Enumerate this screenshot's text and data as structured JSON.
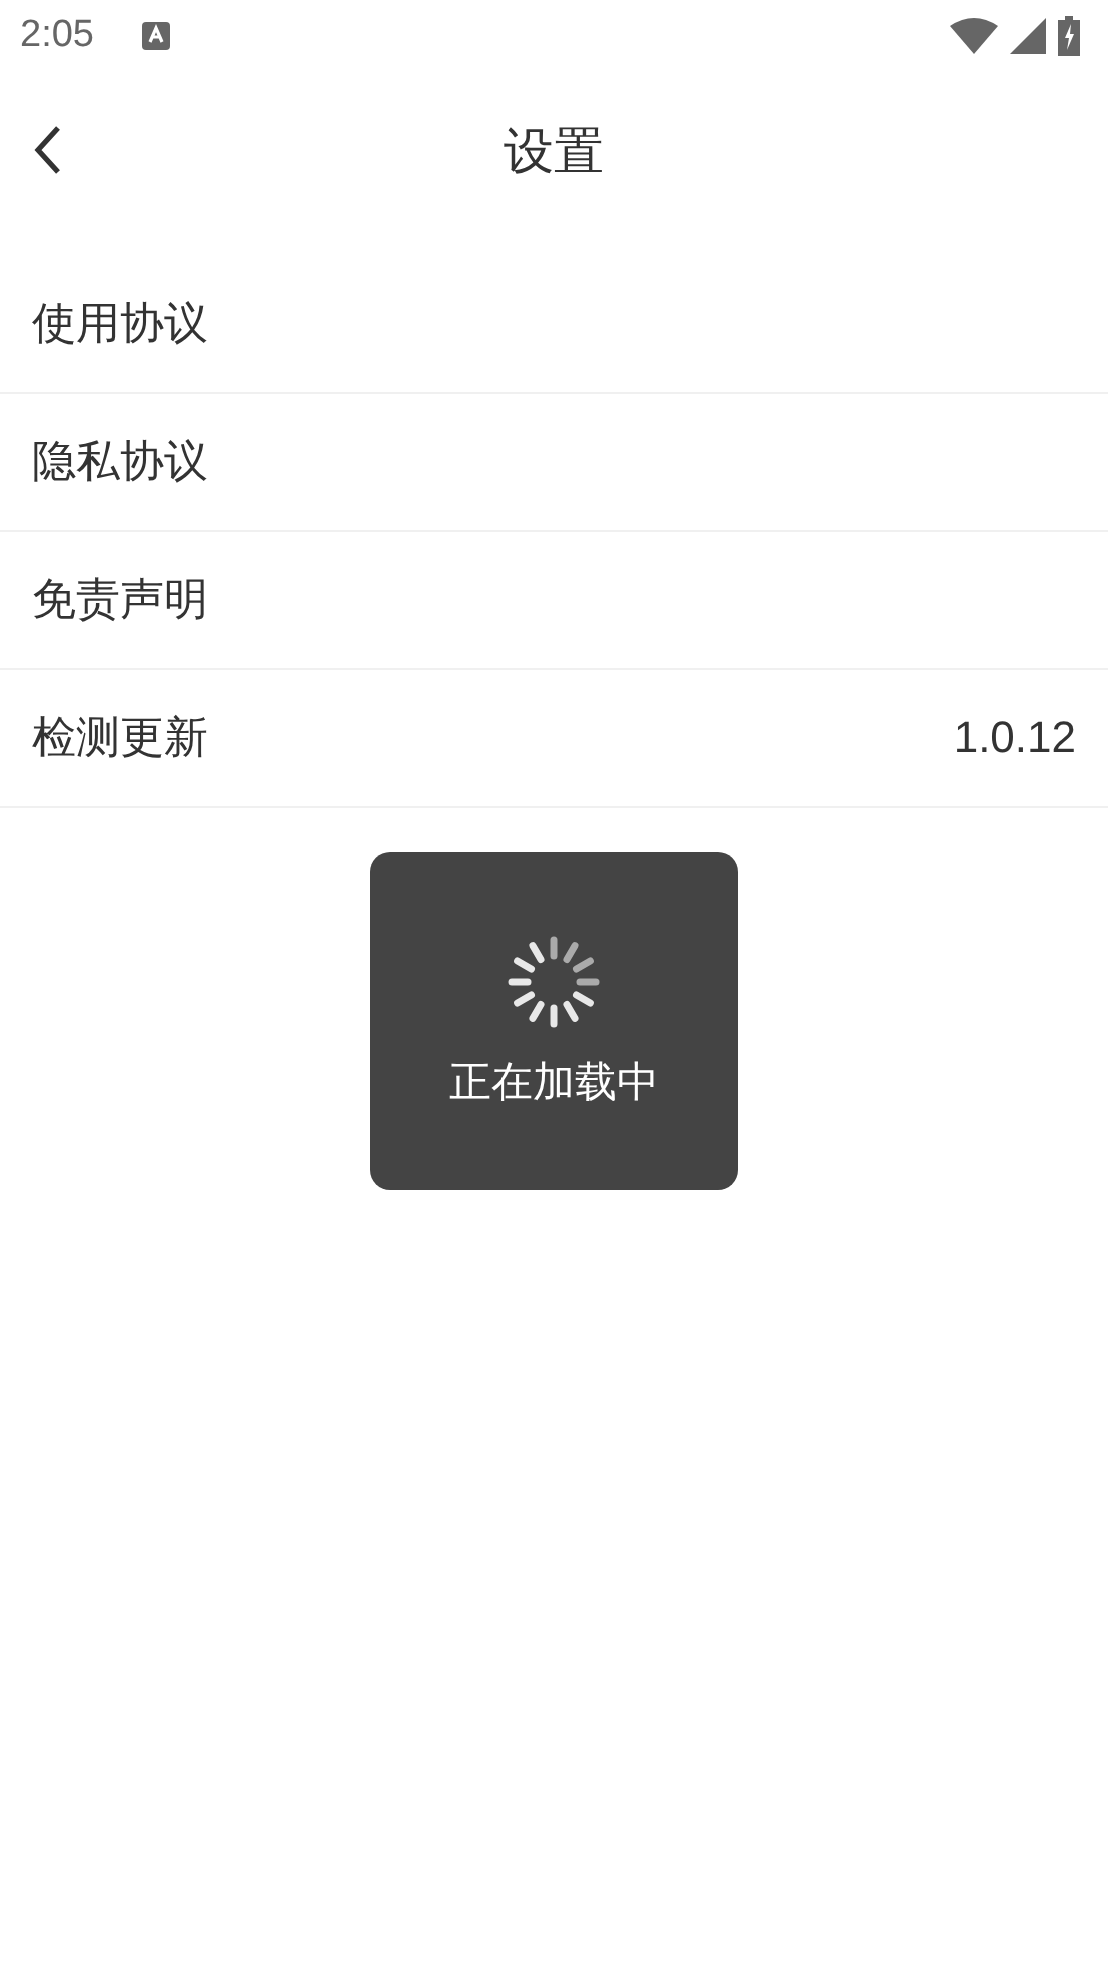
{
  "status_bar": {
    "time": "2:05"
  },
  "header": {
    "title": "设置"
  },
  "settings": {
    "items": [
      {
        "label": "使用协议"
      },
      {
        "label": "隐私协议"
      },
      {
        "label": "免责声明"
      },
      {
        "label": "检测更新",
        "value": "1.0.12"
      }
    ]
  },
  "loading_toast": {
    "message": "正在加载中"
  }
}
